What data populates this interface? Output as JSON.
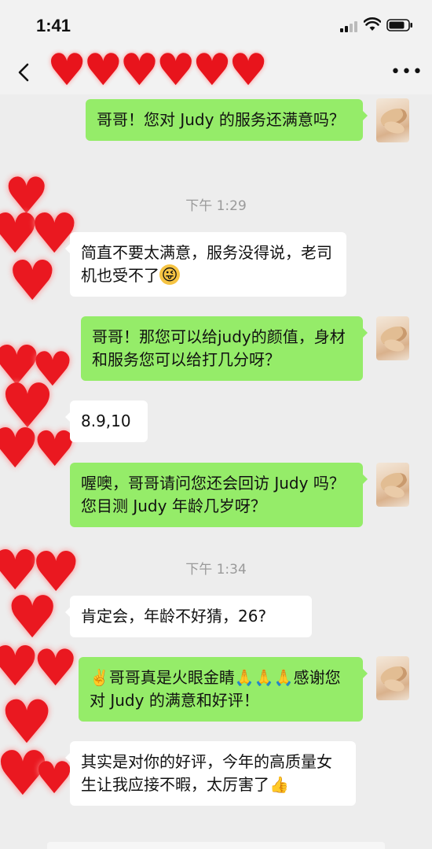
{
  "status_bar": {
    "time": "1:41"
  },
  "nav": {
    "back_icon": "chevron-left-icon",
    "more_icon": "more-dots-icon",
    "more_label": "•••",
    "title_hearts": "♥♥♥♥♥♥"
  },
  "timestamps": [
    "下午 1:29",
    "下午 1:34"
  ],
  "messages": [
    {
      "side": "me",
      "text": "哥哥！您对 Judy 的服务还满意吗？"
    },
    {
      "side": "other",
      "text": "简直不要太满意，服务没得说，老司机也受不了"
    },
    {
      "side": "me",
      "text": "哥哥！那您可以给judy的颜值，身材和服务您可以给打几分呀？"
    },
    {
      "side": "other",
      "text": "8.9,10"
    },
    {
      "side": "me",
      "text": "喔噢，哥哥请问您还会回访 Judy 吗？您目测 Judy 年龄几岁呀？"
    },
    {
      "side": "other",
      "text": "肯定会，年龄不好猜，26?"
    },
    {
      "side": "me",
      "text": "哥哥真是火眼金睛🙏🙏🙏感谢您对 Judy 的满意和好评！",
      "lead_emoji": "✌️"
    },
    {
      "side": "other",
      "text": "其实是对你的好评，今年的高质量女生让我应接不暇，太厉害了",
      "trail_emoji": "👍"
    }
  ],
  "emoji": {
    "wink": "wink-emoji"
  },
  "colors": {
    "me_bubble": "#95ec69",
    "other_bubble": "#ffffff",
    "background": "#ededed",
    "heart": "#ea1820"
  }
}
